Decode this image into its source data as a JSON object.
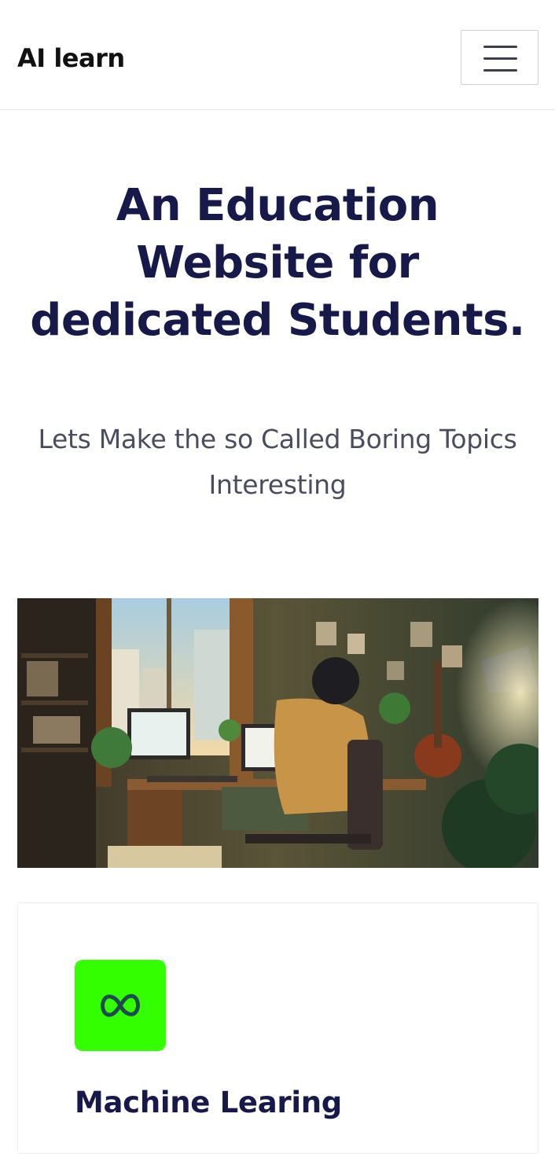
{
  "header": {
    "brand": "AI learn",
    "menu_icon": "hamburger-menu-icon"
  },
  "hero": {
    "title": "An Education Website for dedicated Students.",
    "subtitle": "Lets Make the so Called Boring Topics Interesting",
    "image_icon": "student-desk-illustration"
  },
  "cards": [
    {
      "icon": "meta-infinity-icon",
      "icon_bg": "#33ff00",
      "title": "Machine Learing"
    }
  ],
  "colors": {
    "heading": "#17194a",
    "subtitle": "#4a4c60",
    "accent_green": "#33ff00"
  }
}
